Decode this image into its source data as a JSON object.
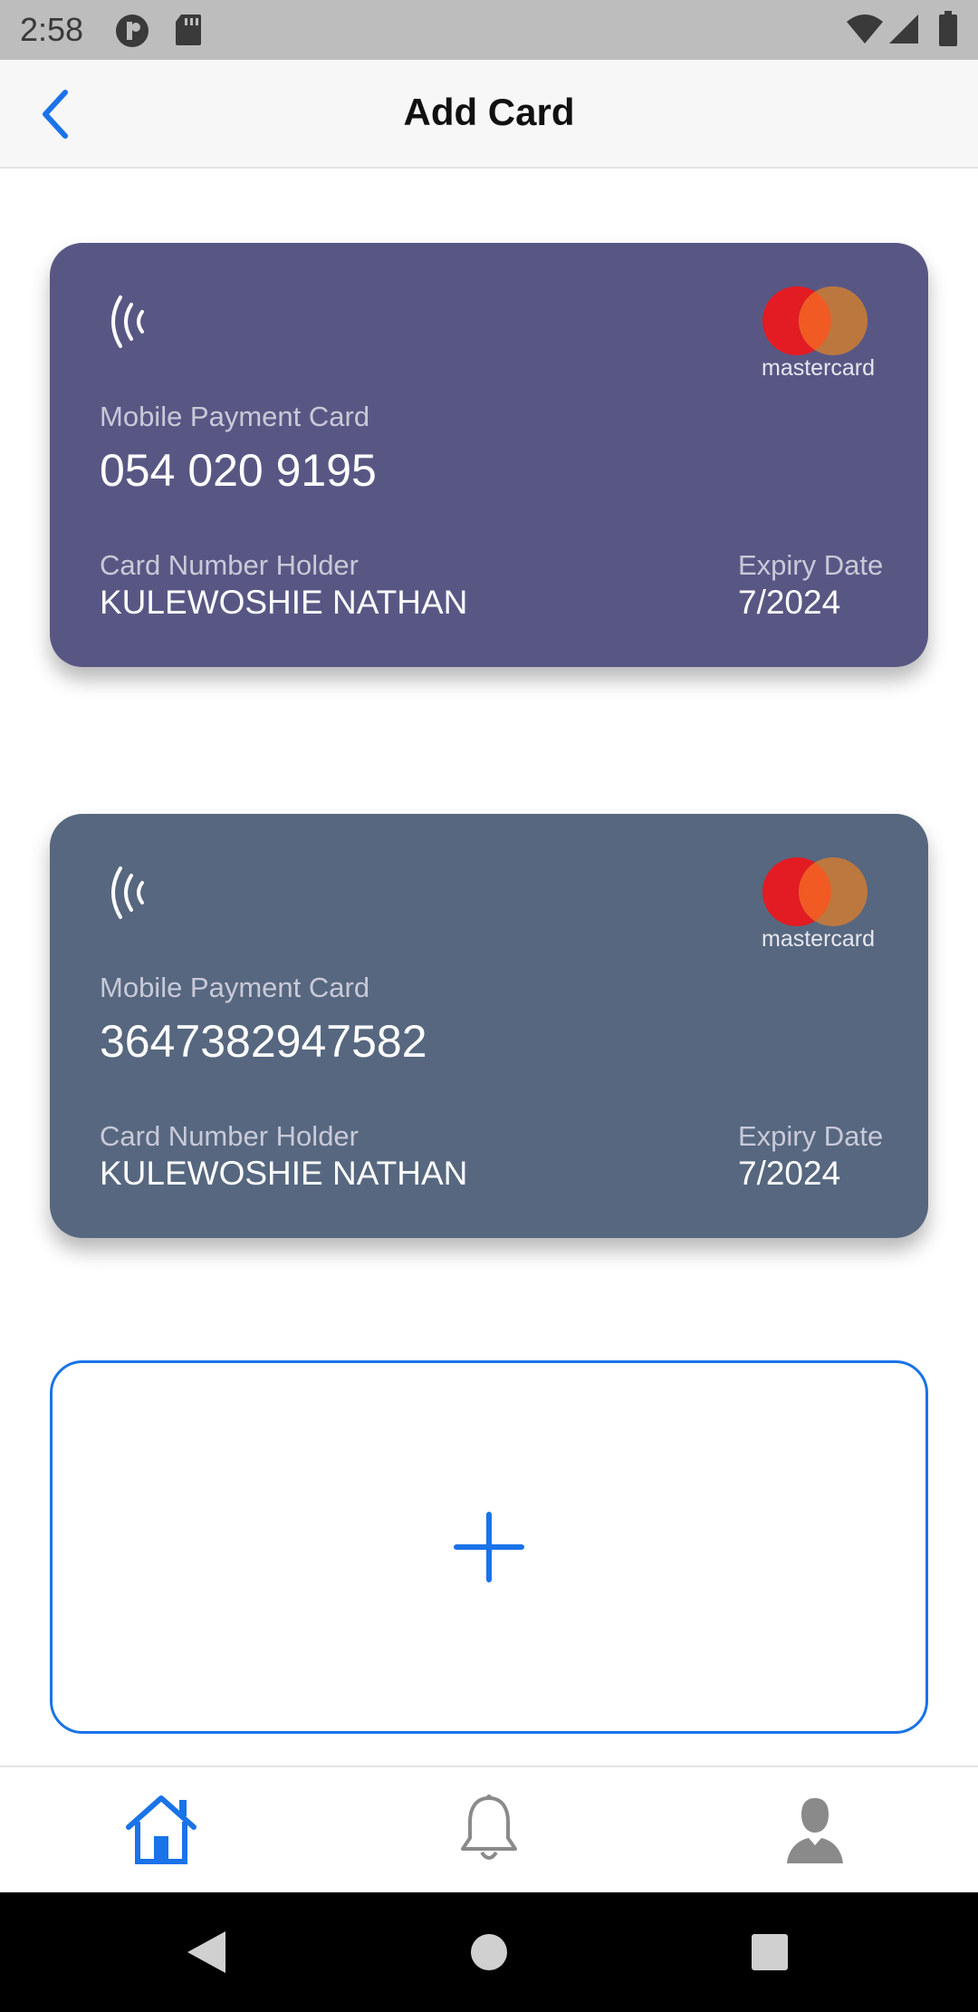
{
  "status_bar": {
    "time": "2:58",
    "icons": [
      "app-notification-icon",
      "sd-card-icon",
      "wifi-icon",
      "signal-icon",
      "battery-icon"
    ]
  },
  "app_bar": {
    "back_icon": "chevron-left-icon",
    "title": "Add Card"
  },
  "cards": [
    {
      "type_label": "Mobile Payment Card",
      "number": "054 020 9195",
      "holder_label": "Card Number Holder",
      "holder_name": "KULEWOSHIE NATHAN",
      "expiry_label": "Expiry Date",
      "expiry": "7/2024",
      "brand": "mastercard",
      "color": "#585784"
    },
    {
      "type_label": "Mobile Payment Card",
      "number": "3647382947582",
      "holder_label": "Card Number Holder",
      "holder_name": "KULEWOSHIE NATHAN",
      "expiry_label": "Expiry Date",
      "expiry": "7/2024",
      "brand": "mastercard",
      "color": "#56677f"
    }
  ],
  "add_card": {
    "icon": "plus-icon",
    "accent": "#1a73e8"
  },
  "bottom_nav": {
    "items": [
      {
        "icon": "home-icon",
        "active": true
      },
      {
        "icon": "bell-icon",
        "active": false
      },
      {
        "icon": "user-icon",
        "active": false
      }
    ],
    "active_color": "#1a73e8",
    "inactive_color": "#8a8a8a"
  },
  "system_nav": {
    "icons": [
      "back-triangle-icon",
      "home-circle-icon",
      "recents-square-icon"
    ]
  }
}
